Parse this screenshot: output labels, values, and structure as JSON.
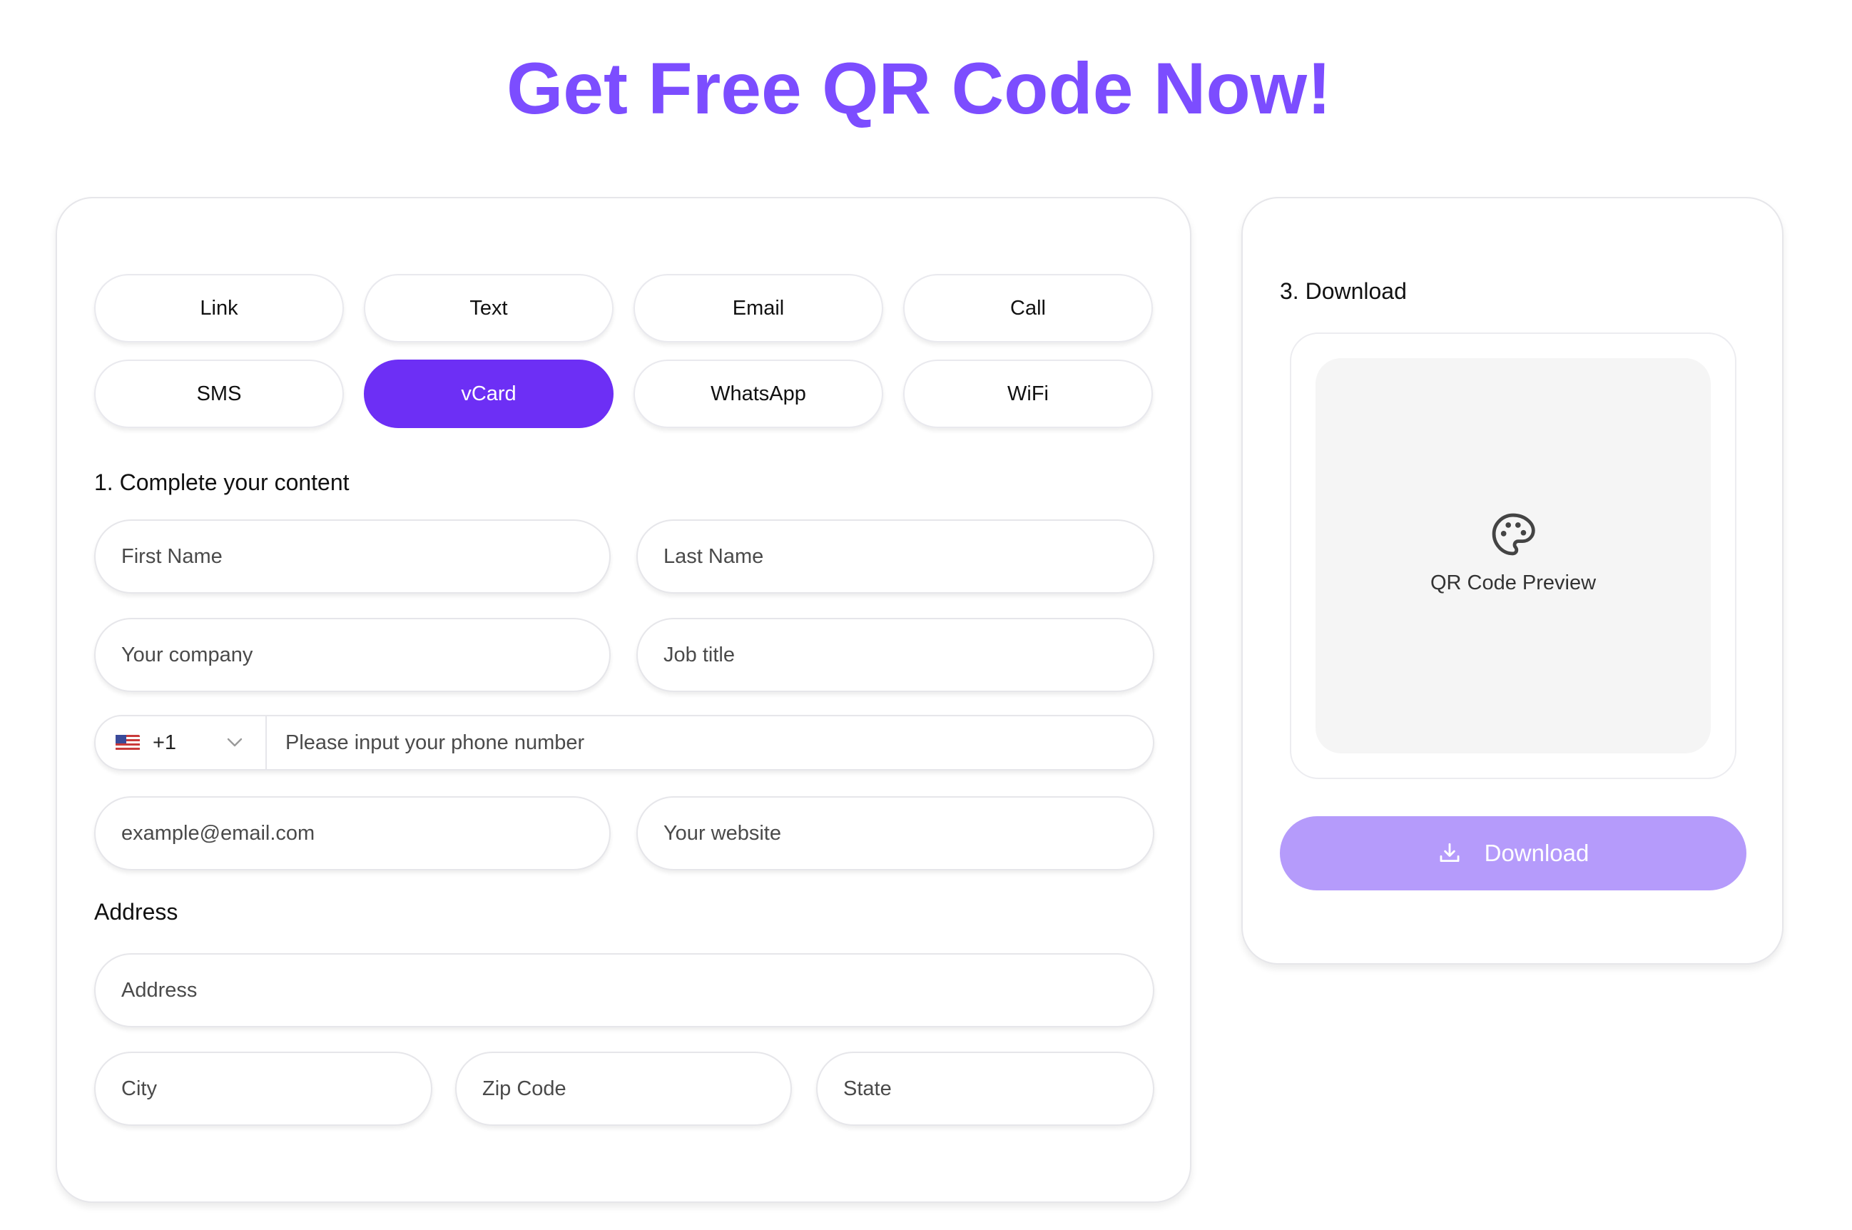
{
  "header": {
    "title": "Get Free QR Code Now!"
  },
  "types": [
    {
      "label": "Link",
      "active": false
    },
    {
      "label": "Text",
      "active": false
    },
    {
      "label": "Email",
      "active": false
    },
    {
      "label": "Call",
      "active": false
    },
    {
      "label": "SMS",
      "active": false
    },
    {
      "label": "vCard",
      "active": true
    },
    {
      "label": "WhatsApp",
      "active": false
    },
    {
      "label": "WiFi",
      "active": false
    }
  ],
  "content": {
    "heading": "1. Complete your content",
    "first_name_placeholder": "First Name",
    "last_name_placeholder": "Last Name",
    "company_placeholder": "Your company",
    "job_title_placeholder": "Job title",
    "phone": {
      "flag_icon": "us-flag-icon",
      "dial_code": "+1",
      "placeholder": "Please input your phone number"
    },
    "email_placeholder": "example@email.com",
    "website_placeholder": "Your website"
  },
  "address": {
    "heading": "Address",
    "address_placeholder": "Address",
    "city_placeholder": "City",
    "zip_placeholder": "Zip Code",
    "state_placeholder": "State"
  },
  "download": {
    "heading": "3. Download",
    "preview_icon": "palette-icon",
    "preview_label": "QR Code Preview",
    "button_icon": "download-icon",
    "button_label": "Download"
  },
  "colors": {
    "accent": "#7c4dff",
    "active_button": "#6d2ff5",
    "download_button": "#b59bfb",
    "preview_bg": "#f5f5f5"
  }
}
